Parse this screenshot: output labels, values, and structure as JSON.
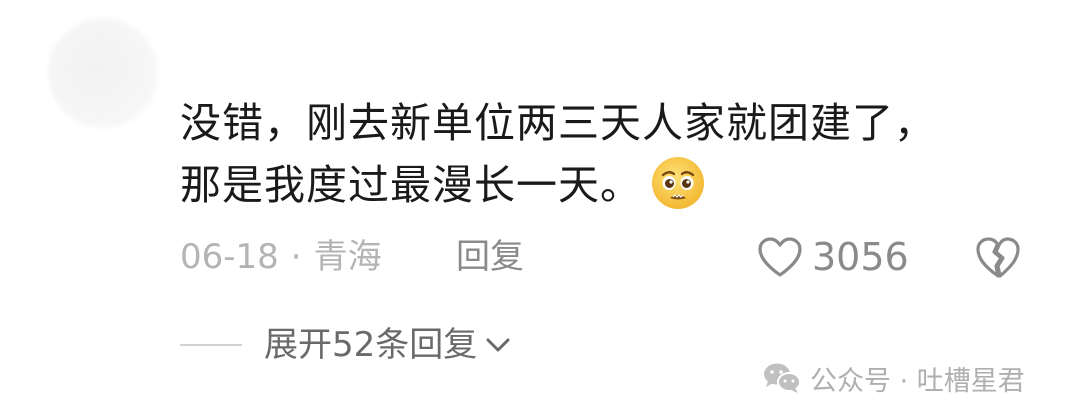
{
  "comment": {
    "author": "",
    "text_line1": "没错，刚去新单位两三天人家就团建了，",
    "text_line2": "那是我度过最漫长一天。",
    "emoji": "pleading-face-emoji"
  },
  "meta": {
    "date": "06-18",
    "separator": "·",
    "location": "青海",
    "reply_label": "回复"
  },
  "actions": {
    "like_icon": "heart-outline-icon",
    "like_count": "3056",
    "dislike_icon": "broken-heart-icon"
  },
  "replies": {
    "expand_label": "展开52条回复",
    "expand_icon": "chevron-down-icon"
  },
  "watermark": {
    "icon": "wechat-icon",
    "text": "公众号 · 吐槽星君"
  },
  "colors": {
    "text_primary": "#1a1a1a",
    "text_secondary": "#b4b4b4",
    "icon_gray": "#8a8a8a",
    "emoji_yellow": "#f7c948"
  }
}
